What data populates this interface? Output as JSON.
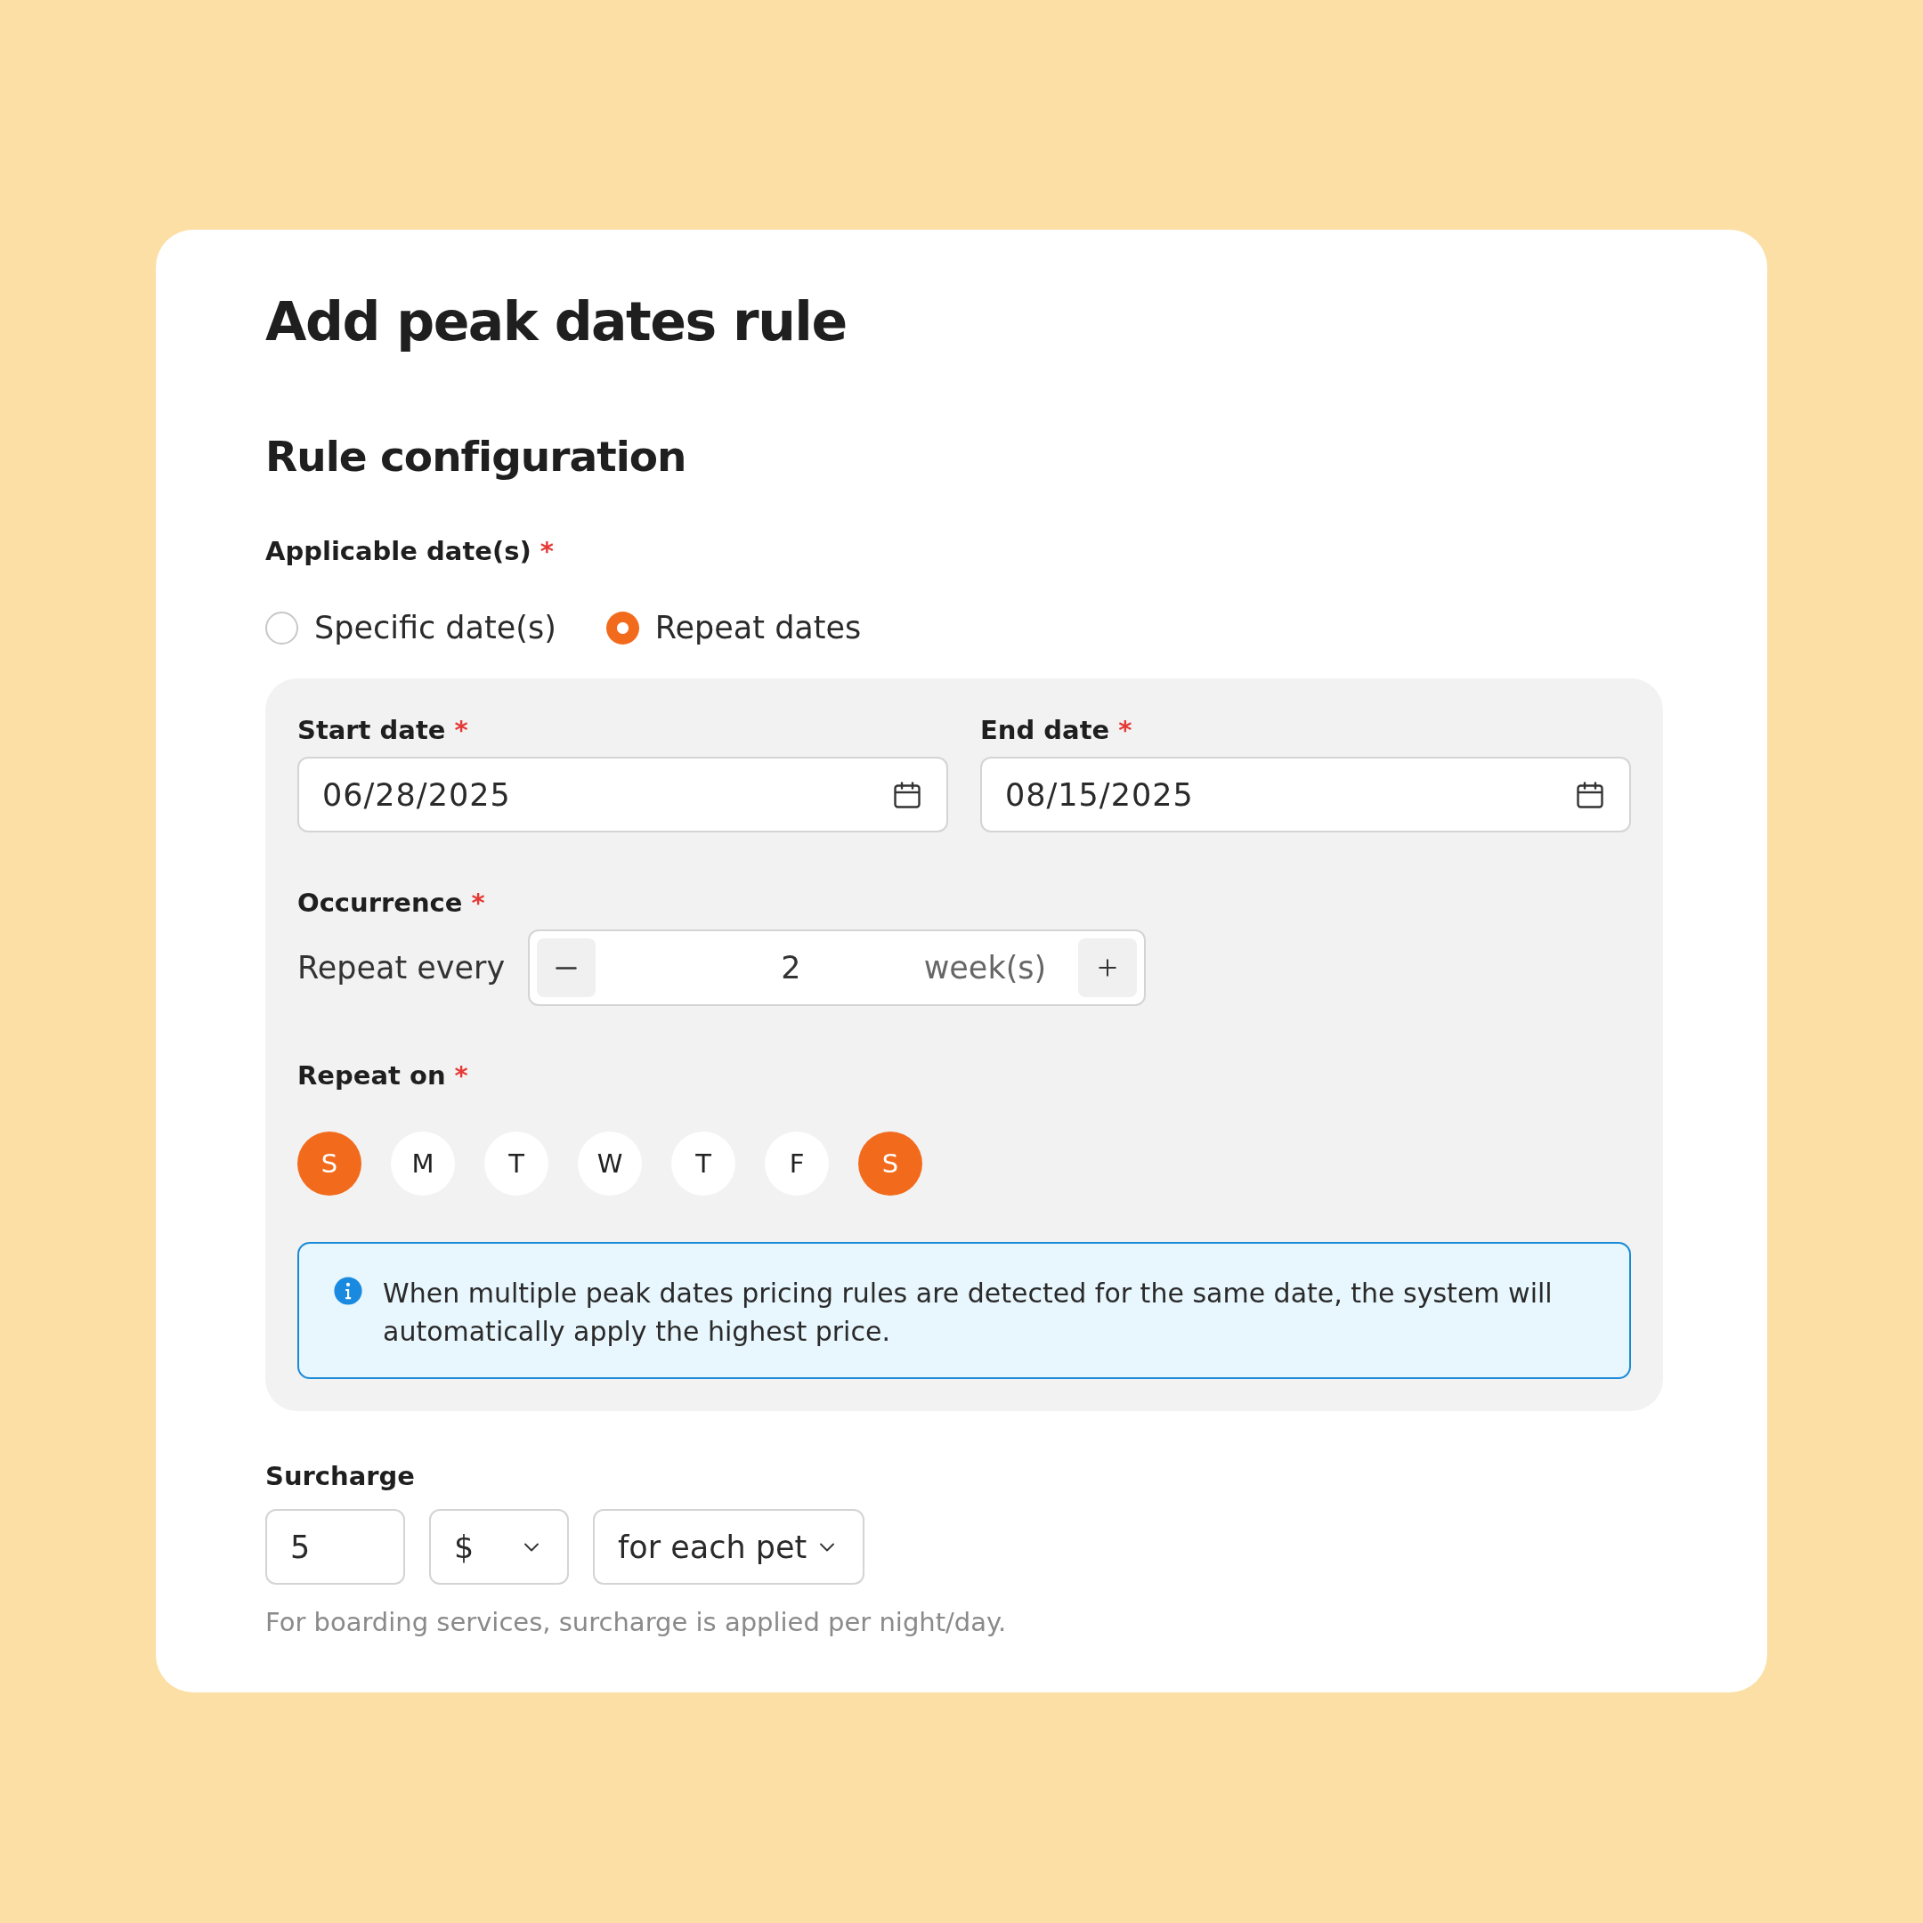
{
  "title": "Add peak dates rule",
  "section_title": "Rule configuration",
  "applicable": {
    "label": "Applicable date(s)",
    "required_mark": "*",
    "options": [
      {
        "label": "Specific date(s)",
        "selected": false
      },
      {
        "label": "Repeat dates",
        "selected": true
      }
    ]
  },
  "dates": [
    {
      "label": "Start date",
      "required_mark": "*",
      "value": "06/28/2025"
    },
    {
      "label": "End date",
      "required_mark": "*",
      "value": "08/15/2025"
    }
  ],
  "occurrence": {
    "label": "Occurrence",
    "required_mark": "*",
    "prefix": "Repeat every",
    "value": "2",
    "unit": "week(s)"
  },
  "repeat_on": {
    "label": "Repeat on",
    "required_mark": "*",
    "days": [
      {
        "label": "S",
        "selected": true
      },
      {
        "label": "M",
        "selected": false
      },
      {
        "label": "T",
        "selected": false
      },
      {
        "label": "W",
        "selected": false
      },
      {
        "label": "T",
        "selected": false
      },
      {
        "label": "F",
        "selected": false
      },
      {
        "label": "S",
        "selected": true
      }
    ]
  },
  "info": "When multiple peak dates pricing rules are detected for the same date, the system will automatically apply the highest price.",
  "surcharge": {
    "label": "Surcharge",
    "amount": "5",
    "currency": "$",
    "basis": "for each pet",
    "help": "For boarding services, surcharge is applied per night/day."
  }
}
